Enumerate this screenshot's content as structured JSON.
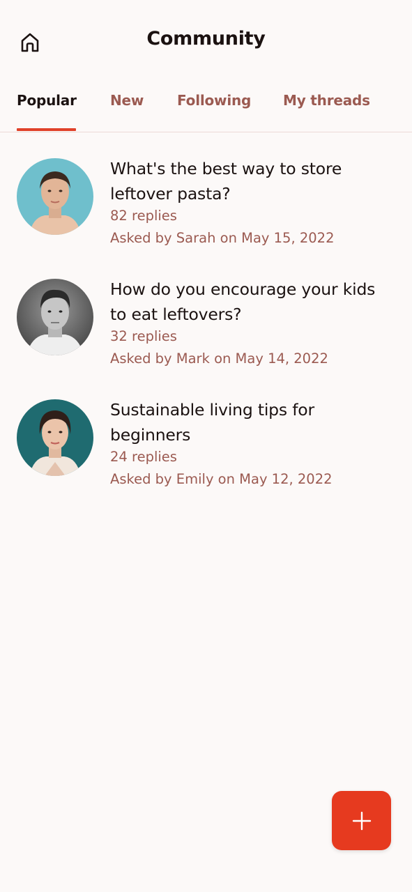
{
  "header": {
    "title": "Community",
    "home_icon": "home-icon"
  },
  "tabs": [
    {
      "label": "Popular",
      "active": true
    },
    {
      "label": "New",
      "active": false
    },
    {
      "label": "Following",
      "active": false
    },
    {
      "label": "My threads",
      "active": false
    }
  ],
  "threads": [
    {
      "title": "What's the best way to store leftover pasta?",
      "replies": "82 replies",
      "meta": "Asked by Sarah on May 15, 2022",
      "avatar_bg": "#6fbfcc"
    },
    {
      "title": "How do you encourage your kids to eat leftovers?",
      "replies": "32 replies",
      "meta": "Asked by Mark on May 14, 2022",
      "avatar_bg": "#8d8d8d"
    },
    {
      "title": "Sustainable living tips for beginners",
      "replies": "24 replies",
      "meta": "Asked by Emily on May 12, 2022",
      "avatar_bg": "#1f6b70"
    }
  ],
  "fab": {
    "icon": "plus-icon"
  },
  "colors": {
    "accent": "#e63a1f",
    "muted_text": "#9b5a51",
    "primary_text": "#1b1211",
    "background": "#fcf9f8"
  }
}
